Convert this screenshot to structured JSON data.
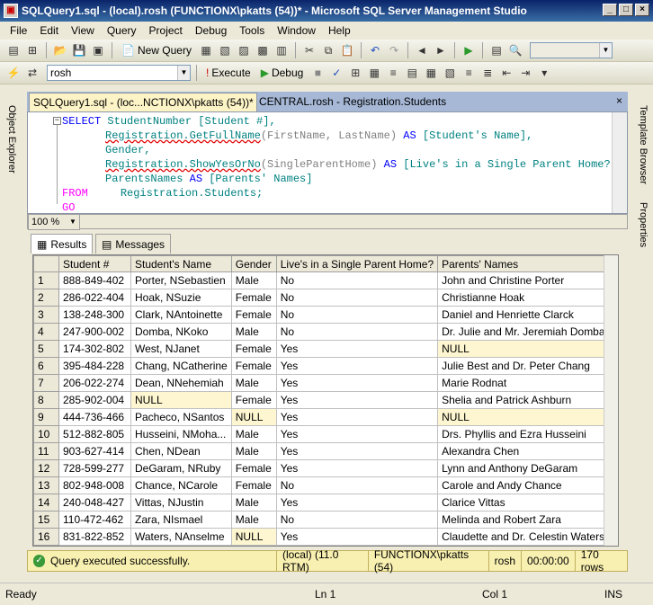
{
  "window": {
    "title": "SQLQuery1.sql - (local).rosh (FUNCTIONX\\pkatts (54))* - Microsoft SQL Server Management Studio"
  },
  "menu": [
    "File",
    "Edit",
    "View",
    "Query",
    "Project",
    "Debug",
    "Tools",
    "Window",
    "Help"
  ],
  "toolbar": {
    "new_query": "New Query",
    "database": "rosh",
    "execute": "Execute",
    "debug": "Debug"
  },
  "sidepanels": {
    "left": "Object Explorer",
    "right_top": "Template Browser",
    "right_bottom": "Properties"
  },
  "doc_tabs": {
    "active": "SQLQuery1.sql - (loc...NCTIONX\\pkatts (54))*",
    "inactive": "CENTRAL.rosh - Registration.Students",
    "close": "×"
  },
  "code": {
    "l1_kw": "SELECT",
    "l1_rest": " StudentNumber [Student #],",
    "l2_fn": "Registration.GetFullName",
    "l2_args": "(FirstName, LastName) ",
    "l2_as": "AS",
    "l2_alias": " [Student's Name],",
    "l3": "Gender,",
    "l4_fn": "Registration.ShowYesOrNo",
    "l4_args": "(SingleParentHome) ",
    "l4_as": "AS",
    "l4_alias": " [Live's in a Single Parent Home?],",
    "l5_col": "ParentsNames ",
    "l5_as": "AS",
    "l5_alias": " [Parents' Names]",
    "l6_kw": "FROM",
    "l6_rest": "     Registration.Students;",
    "l7_kw": "GO"
  },
  "zoom": "100 %",
  "result_tabs": {
    "results": "Results",
    "messages": "Messages"
  },
  "grid": {
    "headers": [
      "Student #",
      "Student's Name",
      "Gender",
      "Live's in a Single Parent Home?",
      "Parents' Names"
    ],
    "rows": [
      [
        "1",
        "888-849-402",
        "Porter, NSebastien",
        "Male",
        "No",
        "John and Christine Porter"
      ],
      [
        "2",
        "286-022-404",
        "Hoak, NSuzie",
        "Female",
        "No",
        "Christianne Hoak"
      ],
      [
        "3",
        "138-248-300",
        "Clark, NAntoinette",
        "Female",
        "No",
        "Daniel and Henriette Clarck"
      ],
      [
        "4",
        "247-900-002",
        "Domba, NKoko",
        "Male",
        "No",
        "Dr. Julie and Mr. Jeremiah Domba"
      ],
      [
        "5",
        "174-302-802",
        "West, NJanet",
        "Female",
        "Yes",
        "NULL"
      ],
      [
        "6",
        "395-484-228",
        "Chang, NCatherine",
        "Female",
        "Yes",
        "Julie Best and Dr. Peter Chang"
      ],
      [
        "7",
        "206-022-274",
        "Dean, NNehemiah",
        "Male",
        "Yes",
        "Marie Rodnat"
      ],
      [
        "8",
        "285-902-004",
        "NULL",
        "Female",
        "Yes",
        "Shelia and Patrick Ashburn"
      ],
      [
        "9",
        "444-736-466",
        "Pacheco, NSantos",
        "NULL",
        "Yes",
        "NULL"
      ],
      [
        "10",
        "512-882-805",
        "Husseini, NMoha...",
        "Male",
        "Yes",
        "Drs. Phyllis and Ezra Husseini"
      ],
      [
        "11",
        "903-627-414",
        "Chen, NDean",
        "Male",
        "Yes",
        "Alexandra Chen"
      ],
      [
        "12",
        "728-599-277",
        "DeGaram, NRuby",
        "Female",
        "Yes",
        "Lynn and Anthony DeGaram"
      ],
      [
        "13",
        "802-948-008",
        "Chance, NCarole",
        "Female",
        "No",
        "Carole and Andy Chance"
      ],
      [
        "14",
        "240-048-427",
        "Vittas, NJustin",
        "Male",
        "Yes",
        "Clarice Vittas"
      ],
      [
        "15",
        "110-472-462",
        "Zara, NIsmael",
        "Male",
        "No",
        "Melinda and Robert Zara"
      ],
      [
        "16",
        "831-822-852",
        "Waters, NAnselme",
        "NULL",
        "Yes",
        "Claudette and Dr. Celestin Waters"
      ]
    ]
  },
  "query_status": {
    "message": "Query executed successfully.",
    "server": "(local) (11.0 RTM)",
    "user": "FUNCTIONX\\pkatts (54)",
    "db": "rosh",
    "time": "00:00:00",
    "rows": "170 rows"
  },
  "statusbar": {
    "ready": "Ready",
    "ln": "Ln 1",
    "col": "Col 1",
    "ins": "INS"
  }
}
